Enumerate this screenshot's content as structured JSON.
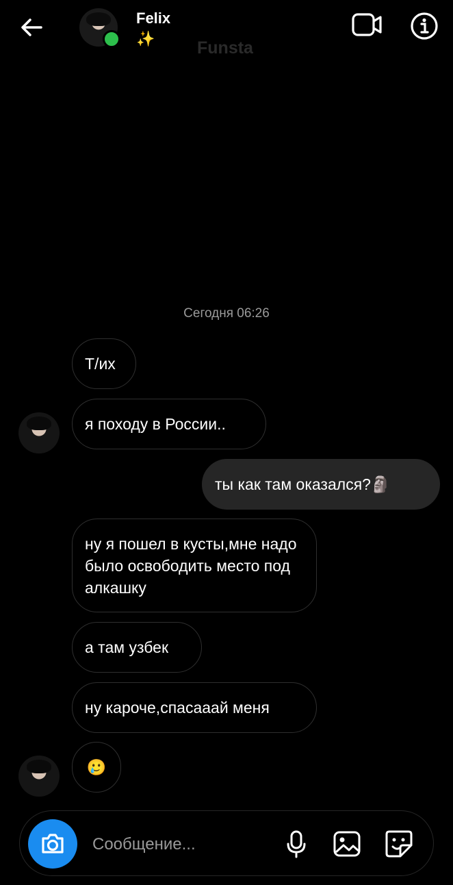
{
  "header": {
    "name": "Felix",
    "subtitle": "✨",
    "watermark": "Funsta",
    "back_icon": "arrow-left-icon",
    "video_icon": "video-camera-icon",
    "info_icon": "info-icon",
    "online_color": "#2dbf4c"
  },
  "chat": {
    "timestamp": "Сегодня 06:26",
    "messages": [
      {
        "direction": "incoming",
        "text": "Т/их"
      },
      {
        "direction": "incoming",
        "text": "я походу в России.."
      },
      {
        "direction": "outgoing",
        "text": "ты как там оказался?🗿"
      },
      {
        "direction": "incoming",
        "text": "ну я пошел в кусты,мне надо было освободить место под алкашку"
      },
      {
        "direction": "incoming",
        "text": "а там узбек"
      },
      {
        "direction": "incoming",
        "text": "ну кароче,спасааай меня"
      },
      {
        "direction": "incoming",
        "text": "🥲"
      }
    ]
  },
  "composer": {
    "placeholder": "Сообщение...",
    "camera_icon": "camera-icon",
    "mic_icon": "microphone-icon",
    "gallery_icon": "image-gallery-icon",
    "sticker_icon": "sticker-icon",
    "accent": "#1a8cf0"
  }
}
